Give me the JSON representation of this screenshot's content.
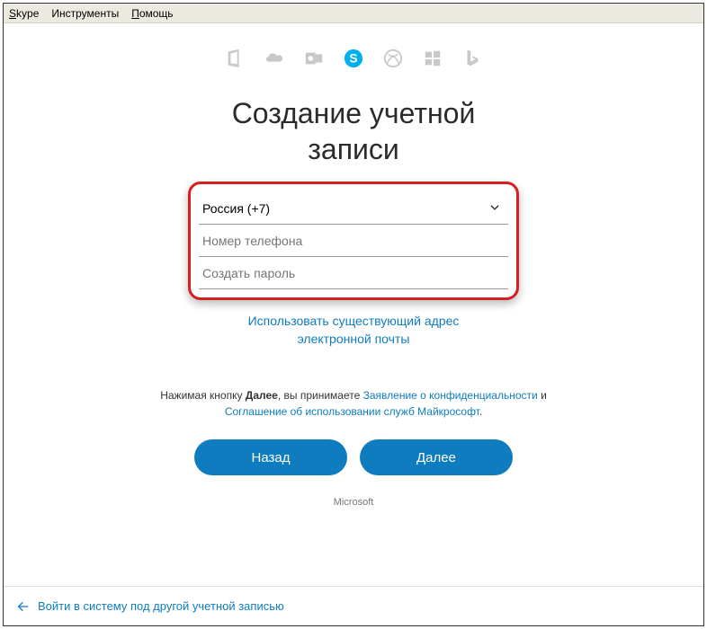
{
  "menu": {
    "item1": "Skype",
    "item2": "Инструменты",
    "item3": "Помощь"
  },
  "title_line1": "Создание учетной",
  "title_line2": "записи",
  "form": {
    "country": "Россия (+7)",
    "phone_placeholder": "Номер телефона",
    "password_placeholder": "Создать пароль"
  },
  "alt_link_line1": "Использовать существующий адрес",
  "alt_link_line2": "электронной почты",
  "legal": {
    "pre": "Нажимая кнопку ",
    "next_word": "Далее",
    "mid1": ", вы принимаете ",
    "privacy": "Заявление о конфиденциальности",
    "and": " и ",
    "tos": "Соглашение об использовании служб Майкрософт",
    "end": "."
  },
  "buttons": {
    "back": "Назад",
    "next": "Далее"
  },
  "ms": "Microsoft",
  "footer": "Войти в систему под другой учетной записью"
}
